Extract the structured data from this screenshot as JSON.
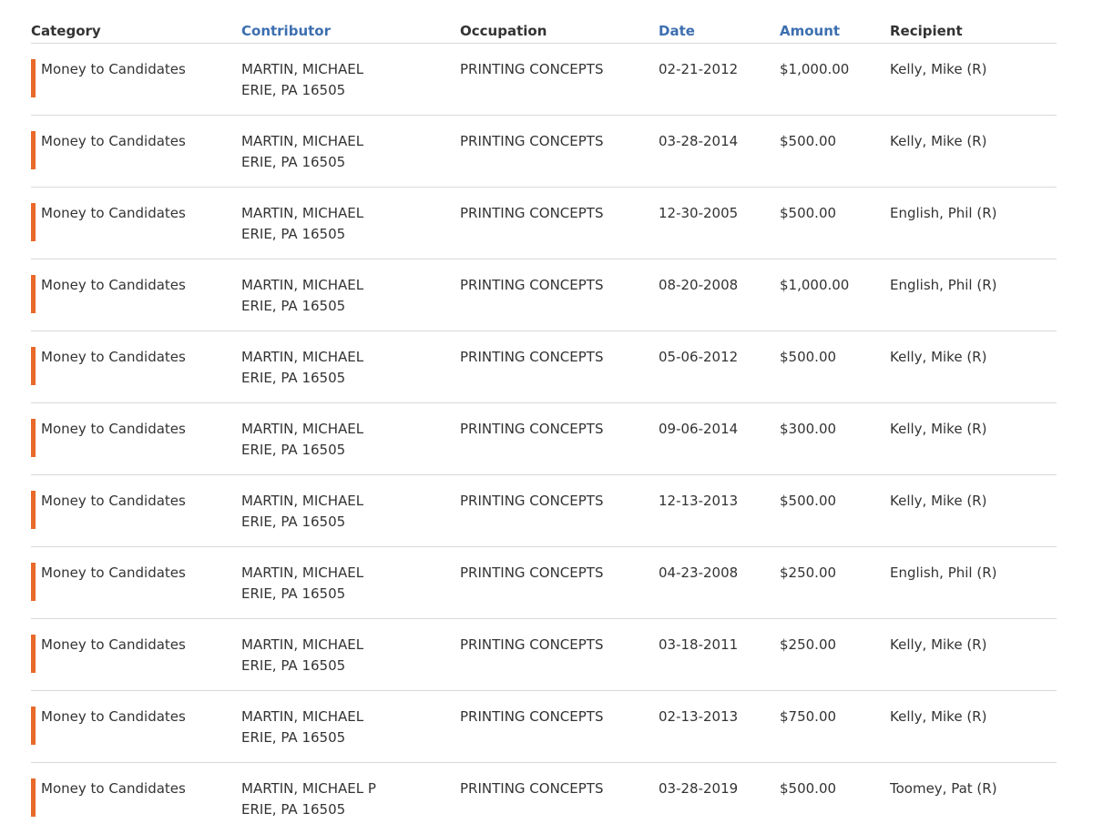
{
  "colors": {
    "accent_bar": "#e8692a",
    "sortable_header": "#3d6fb0",
    "text": "#333333",
    "divider": "#d9d9d9"
  },
  "table": {
    "headers": {
      "category": "Category",
      "contributor": "Contributor",
      "occupation": "Occupation",
      "date": "Date",
      "amount": "Amount",
      "recipient": "Recipient"
    },
    "rows": [
      {
        "category": "Money to Candidates",
        "contributor_name": "MARTIN, MICHAEL",
        "contributor_location": "ERIE, PA 16505",
        "occupation": "PRINTING CONCEPTS",
        "date": "02-21-2012",
        "amount": "$1,000.00",
        "recipient": "Kelly, Mike (R)"
      },
      {
        "category": "Money to Candidates",
        "contributor_name": "MARTIN, MICHAEL",
        "contributor_location": "ERIE, PA 16505",
        "occupation": "PRINTING CONCEPTS",
        "date": "03-28-2014",
        "amount": "$500.00",
        "recipient": "Kelly, Mike (R)"
      },
      {
        "category": "Money to Candidates",
        "contributor_name": "MARTIN, MICHAEL",
        "contributor_location": "ERIE, PA 16505",
        "occupation": "PRINTING CONCEPTS",
        "date": "12-30-2005",
        "amount": "$500.00",
        "recipient": "English, Phil (R)"
      },
      {
        "category": "Money to Candidates",
        "contributor_name": "MARTIN, MICHAEL",
        "contributor_location": "ERIE, PA 16505",
        "occupation": "PRINTING CONCEPTS",
        "date": "08-20-2008",
        "amount": "$1,000.00",
        "recipient": "English, Phil (R)"
      },
      {
        "category": "Money to Candidates",
        "contributor_name": "MARTIN, MICHAEL",
        "contributor_location": "ERIE, PA 16505",
        "occupation": "PRINTING CONCEPTS",
        "date": "05-06-2012",
        "amount": "$500.00",
        "recipient": "Kelly, Mike (R)"
      },
      {
        "category": "Money to Candidates",
        "contributor_name": "MARTIN, MICHAEL",
        "contributor_location": "ERIE, PA 16505",
        "occupation": "PRINTING CONCEPTS",
        "date": "09-06-2014",
        "amount": "$300.00",
        "recipient": "Kelly, Mike (R)"
      },
      {
        "category": "Money to Candidates",
        "contributor_name": "MARTIN, MICHAEL",
        "contributor_location": "ERIE, PA 16505",
        "occupation": "PRINTING CONCEPTS",
        "date": "12-13-2013",
        "amount": "$500.00",
        "recipient": "Kelly, Mike (R)"
      },
      {
        "category": "Money to Candidates",
        "contributor_name": "MARTIN, MICHAEL",
        "contributor_location": "ERIE, PA 16505",
        "occupation": "PRINTING CONCEPTS",
        "date": "04-23-2008",
        "amount": "$250.00",
        "recipient": "English, Phil (R)"
      },
      {
        "category": "Money to Candidates",
        "contributor_name": "MARTIN, MICHAEL",
        "contributor_location": "ERIE, PA 16505",
        "occupation": "PRINTING CONCEPTS",
        "date": "03-18-2011",
        "amount": "$250.00",
        "recipient": "Kelly, Mike (R)"
      },
      {
        "category": "Money to Candidates",
        "contributor_name": "MARTIN, MICHAEL",
        "contributor_location": "ERIE, PA 16505",
        "occupation": "PRINTING CONCEPTS",
        "date": "02-13-2013",
        "amount": "$750.00",
        "recipient": "Kelly, Mike (R)"
      },
      {
        "category": "Money to Candidates",
        "contributor_name": "MARTIN, MICHAEL P",
        "contributor_location": "ERIE, PA 16505",
        "occupation": "PRINTING CONCEPTS",
        "date": "03-28-2019",
        "amount": "$500.00",
        "recipient": "Toomey, Pat (R)"
      }
    ]
  }
}
